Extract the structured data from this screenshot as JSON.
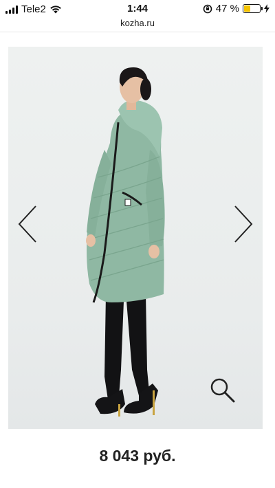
{
  "status_bar": {
    "carrier": "Tele2",
    "time": "1:44",
    "battery_percent": "47 %",
    "battery_level": 0.47,
    "signal_bars": 4
  },
  "browser": {
    "url": "kozha.ru"
  },
  "gallery": {
    "prev_icon": "chevron-left-icon",
    "next_icon": "chevron-right-icon",
    "zoom_icon": "magnifier-icon",
    "photo": "woman-in-mint-green-long-down-coat"
  },
  "product": {
    "price": "8 043 руб."
  },
  "colors": {
    "coat": "#8fb8a3",
    "battery_fill": "#f5c400"
  }
}
